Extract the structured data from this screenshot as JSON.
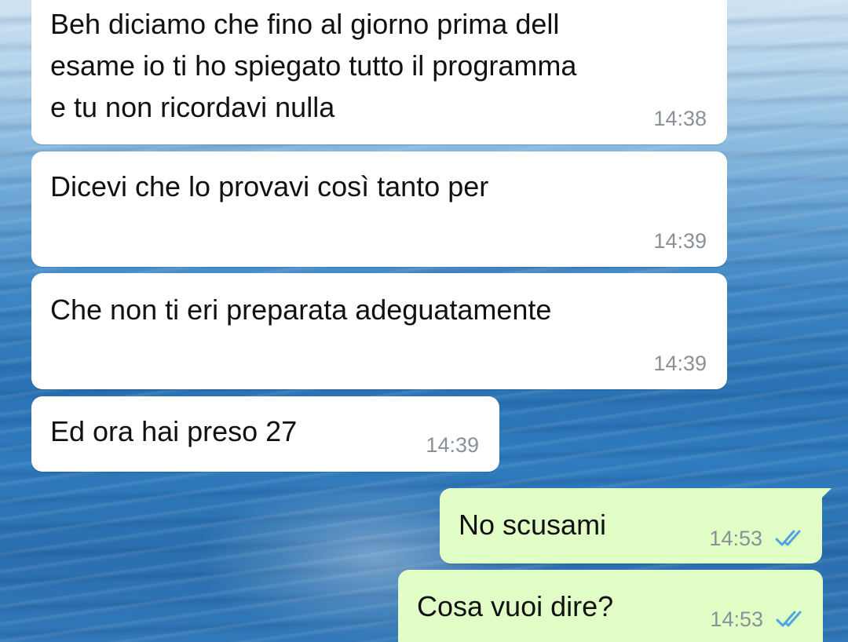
{
  "conversation": {
    "messages": [
      {
        "direction": "incoming",
        "text": "Beh diciamo che fino al giorno prima dell\nesame io ti ho spiegato tutto il programma\ne tu non ricordavi nulla",
        "time": "14:38"
      },
      {
        "direction": "incoming",
        "text": "Dicevi che lo provavi così tanto per",
        "time": "14:39"
      },
      {
        "direction": "incoming",
        "text": "Che non ti eri preparata adeguatamente",
        "time": "14:39"
      },
      {
        "direction": "incoming",
        "text": "Ed ora hai preso 27",
        "time": "14:39"
      },
      {
        "direction": "outgoing",
        "text": "No scusami",
        "time": "14:53",
        "status": "read"
      },
      {
        "direction": "outgoing",
        "text": "Cosa vuoi dire?",
        "time": "14:53",
        "status": "read"
      }
    ]
  },
  "colors": {
    "incoming_bubble": "#ffffff",
    "outgoing_bubble": "#e1fec6",
    "timestamp": "#8a9097",
    "read_ticks": "#4fa3e0"
  },
  "icons": {
    "read_receipt": "double-check-icon"
  }
}
